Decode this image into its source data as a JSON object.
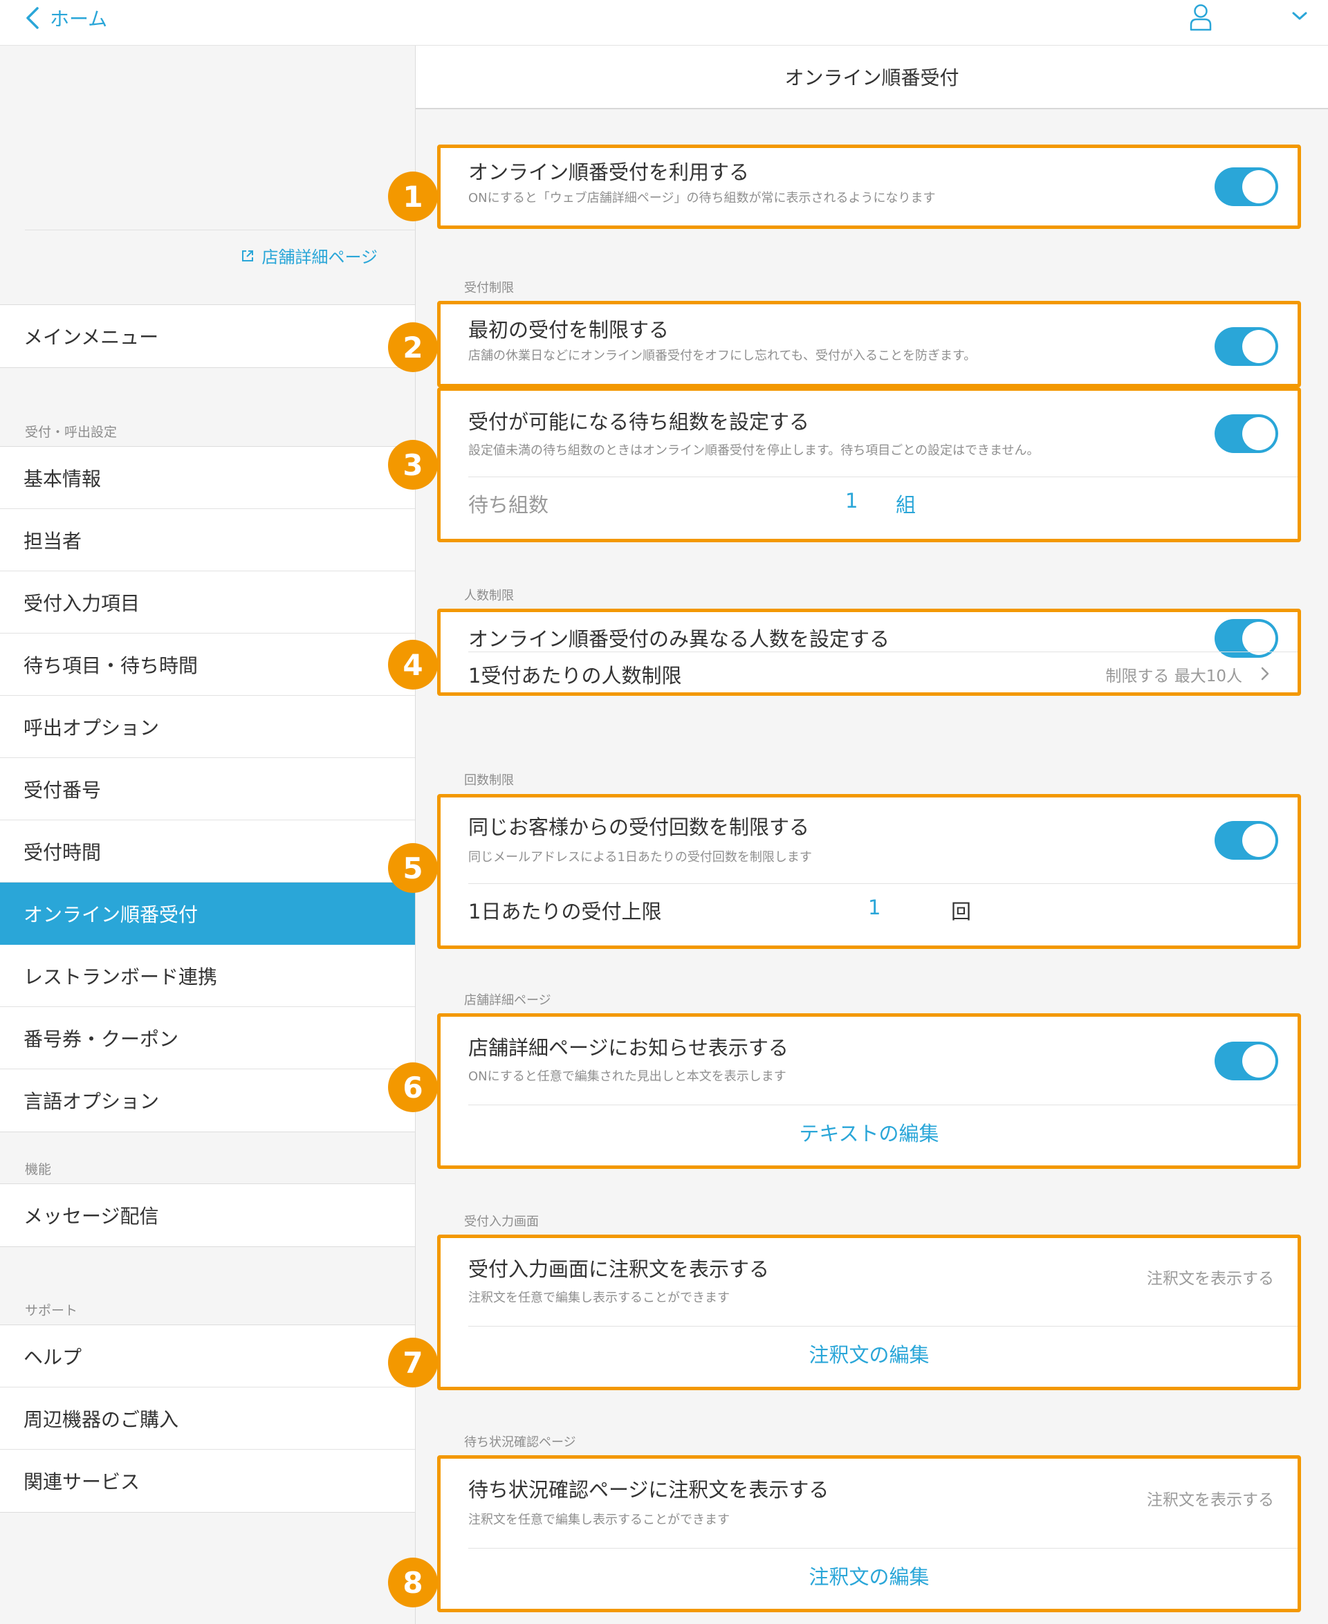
{
  "topbar": {
    "back_label": "ホーム"
  },
  "sidebar": {
    "store_link": "店舗詳細ページ",
    "main_menu": "メインメニュー",
    "section_reception": "受付・呼出設定",
    "reception_items": [
      "基本情報",
      "担当者",
      "受付入力項目",
      "待ち項目・待ち時間",
      "呼出オプション",
      "受付番号",
      "受付時間",
      "オンライン順番受付",
      "レストランボード連携",
      "番号券・クーポン",
      "言語オプション"
    ],
    "active_index": 7,
    "section_features": "機能",
    "feature_items": [
      "メッセージ配信"
    ],
    "section_support": "サポート",
    "support_items": [
      "ヘルプ",
      "周辺機器のご購入",
      "関連サービス"
    ]
  },
  "main": {
    "title": "オンライン順番受付",
    "card1": {
      "badge": "1",
      "title": "オンライン順番受付を利用する",
      "desc": "ONにすると「ウェブ店舗詳細ページ」の待ち組数が常に表示されるようになります",
      "toggle": true
    },
    "section_limit": "受付制限",
    "card2": {
      "badge": "2",
      "title": "最初の受付を制限する",
      "desc": "店舗の休業日などにオンライン順番受付をオフにし忘れても、受付が入ることを防ぎます。",
      "toggle": true
    },
    "card3": {
      "badge": "3",
      "title": "受付が可能になる待ち組数を設定する",
      "desc": "設定値未満の待ち組数のときはオンライン順番受付を停止します。待ち項目ごとの設定はできません。",
      "toggle": true,
      "field_label": "待ち組数",
      "field_value": "1",
      "field_unit": "組"
    },
    "section_people": "人数制限",
    "card4": {
      "badge": "4",
      "title": "オンライン順番受付のみ異なる人数を設定する",
      "toggle": true,
      "row2_label": "1受付あたりの人数制限",
      "row2_value": "制限する 最大10人"
    },
    "section_count": "回数制限",
    "card5": {
      "badge": "5",
      "title": "同じお客様からの受付回数を制限する",
      "desc": "同じメールアドレスによる1日あたりの受付回数を制限します",
      "toggle": true,
      "field_label": "1日あたりの受付上限",
      "field_value": "1",
      "field_unit": "回"
    },
    "section_store": "店舗詳細ページ",
    "card6": {
      "badge": "6",
      "title": "店舗詳細ページにお知らせ表示する",
      "desc": "ONにすると任意で編集された見出しと本文を表示します",
      "toggle": true,
      "link": "テキストの編集"
    },
    "section_input": "受付入力画面",
    "card7": {
      "badge": "7",
      "title": "受付入力画面に注釈文を表示する",
      "desc": "注釈文を任意で編集し表示することができます",
      "right": "注釈文を表示する",
      "link": "注釈文の編集"
    },
    "section_wait": "待ち状況確認ページ",
    "card8": {
      "badge": "8",
      "title": "待ち状況確認ページに注釈文を表示する",
      "desc": "注釈文を任意で編集し表示することができます",
      "right": "注釈文を表示する",
      "link": "注釈文の編集"
    }
  }
}
